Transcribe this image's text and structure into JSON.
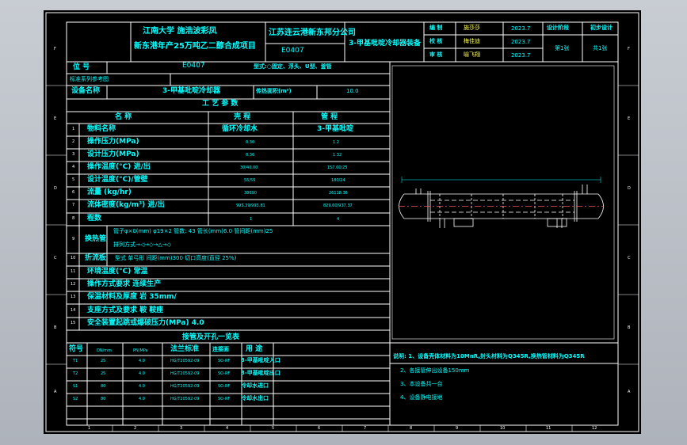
{
  "title_block": {
    "university": "江南大学 施浩波彩凤",
    "project_name": "新东港年产25万吨乙二醇合成项目",
    "plant_name": "江苏连云港新东邦分公司",
    "equipment_name": "3-甲基吡啶冷却器装备",
    "drawing_no": "E0407",
    "roles": [
      "编 制",
      "校 核",
      "审 核"
    ],
    "people": [
      "施莎莎",
      "梅佳迪",
      "喻飞翔"
    ],
    "dates": [
      "2023.7",
      "2023.7",
      "2023.7"
    ],
    "stage_label": "设计阶段",
    "stage_value": "初步设计",
    "sheet_label": "第1张",
    "sheet_total": "共1张"
  },
  "header_rows": {
    "bitno_label": "位 号",
    "bitno_value": "E0407",
    "type_value": "型式:○固定、浮头、U型、釜管",
    "std_label": "标准系列参考图",
    "name_label": "设备名称",
    "name_value": "3-甲基吡啶冷却器",
    "area_label": "传热面积(m²)",
    "area_value": "10.0",
    "process_title": "工 艺 参 数"
  },
  "process_table": {
    "headers": [
      "名 称",
      "壳 程",
      "管 程"
    ],
    "rows": [
      {
        "no": "1",
        "name": "物料名称",
        "shell": "循环冷却水",
        "tube": "3-甲基吡啶"
      },
      {
        "no": "2",
        "name": "操作压力(MPa)",
        "shell": "0.30",
        "tube": "1.2"
      },
      {
        "no": "3",
        "name": "设计压力(MPa)",
        "shell": "0.36",
        "tube": "1.32"
      },
      {
        "no": "4",
        "name": "操作温度(°C) 进/出",
        "shell": "30/40.00",
        "tube": "157.00/25"
      },
      {
        "no": "5",
        "name": "设计温度(°C)/管壁",
        "shell": "55/55",
        "tube": "180/24"
      },
      {
        "no": "6",
        "name": "流量 (kg/hr)",
        "shell": "38690",
        "tube": "26118.36"
      },
      {
        "no": "7",
        "name": "流体密度(kg/m³) 进/出",
        "shell": "995.39/993.81",
        "tube": "829.60/937.37"
      },
      {
        "no": "8",
        "name": "程数",
        "shell": "1",
        "tube": "4"
      }
    ]
  },
  "tube_rows": {
    "no9": "9",
    "label9": "换热管",
    "spec9": "管子φ×δ(mm) φ19×2 管数: 43 管长(mm)6.0 管间距(mm)25",
    "layout9": "排列方式→◁→◇→△→◇",
    "no10": "10",
    "label10": "折流板",
    "spec10": "型式 单弓形 间距(mm)300 切口高度(直径 25%)",
    "rows": [
      {
        "no": "11",
        "text": "环境温度(°C) 常温"
      },
      {
        "no": "12",
        "text": "操作方式要求 连续生产"
      },
      {
        "no": "13",
        "text": "保温材料及厚度 岩 35mm/"
      },
      {
        "no": "14",
        "text": "支座方式及要求 鞍 鞍座"
      },
      {
        "no": "15",
        "text": "安全装置起跳或爆破压力(MPa) 4.0"
      }
    ]
  },
  "nozzle_table": {
    "title": "接管及开孔一览表",
    "headers": [
      "符号",
      "DN/mm",
      "PN/MPa",
      "法兰标准",
      "连接面",
      "用 途"
    ],
    "rows": [
      {
        "sym": "T1",
        "dn": "25",
        "pn": "4.0",
        "std": "HG/T20592-09",
        "face": "SO-RF",
        "use": "3-甲基吡啶入口"
      },
      {
        "sym": "T2",
        "dn": "25",
        "pn": "4.0",
        "std": "HG/T20592-09",
        "face": "SO-RF",
        "use": "3-甲基吡啶出口"
      },
      {
        "sym": "S1",
        "dn": "80",
        "pn": "4.0",
        "std": "HG/T20592-09",
        "face": "SO-RF",
        "use": "冷却水进口"
      },
      {
        "sym": "S2",
        "dn": "80",
        "pn": "4.0",
        "std": "HG/T20592-09",
        "face": "SO-RF",
        "use": "冷却水出口"
      }
    ]
  },
  "notes": [
    "说明: 1、设备壳体材料为10MnR,封头材料为Q345R,换热管材料为Q345R",
    "2、各接管伸出设备150mm",
    "3、本设备共一台",
    "4、设备静电接地"
  ],
  "grid_letters": [
    "F",
    "E",
    "D",
    "C",
    "B",
    "A"
  ],
  "grid_numbers": [
    "1",
    "2",
    "3",
    "4",
    "5",
    "6",
    "7",
    "8",
    "9",
    "10",
    "11",
    "12"
  ],
  "colors": {
    "frame": "#ffffff",
    "text": "#00ffff",
    "highlight": "#ffff55",
    "background": "#000000"
  }
}
